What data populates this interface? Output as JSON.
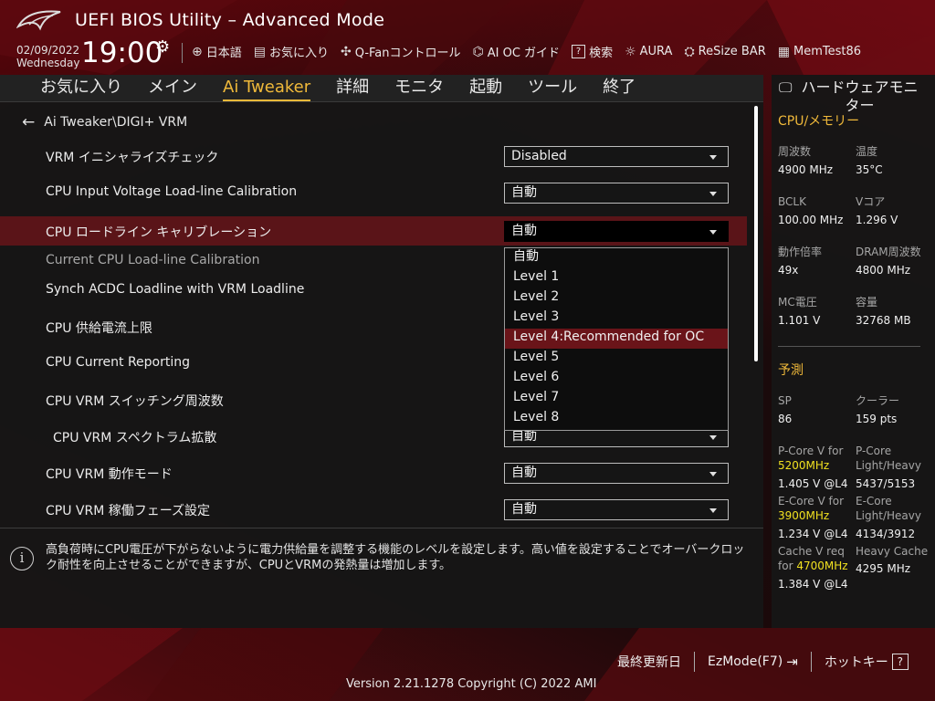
{
  "header": {
    "title": "UEFI BIOS Utility – Advanced Mode",
    "date": "02/09/2022",
    "weekday": "Wednesday",
    "time": "19:00"
  },
  "toolbar": [
    {
      "icon": "globe-icon",
      "label": "日本語"
    },
    {
      "icon": "favorites-icon",
      "label": "お気に入り"
    },
    {
      "icon": "fan-icon",
      "label": "Q-Fanコントロール"
    },
    {
      "icon": "ai-oc-icon",
      "label": "AI OC ガイド"
    },
    {
      "icon": "search-icon",
      "label": "検索"
    },
    {
      "icon": "aura-icon",
      "label": "AURA"
    },
    {
      "icon": "resize-bar-icon",
      "label": "ReSize BAR"
    },
    {
      "icon": "memtest-icon",
      "label": "MemTest86"
    }
  ],
  "nav": {
    "tabs": [
      "お気に入り",
      "メイン",
      "Ai Tweaker",
      "詳細",
      "モニタ",
      "起動",
      "ツール",
      "終了"
    ],
    "active": "Ai Tweaker"
  },
  "breadcrumb": "Ai Tweaker\\DIGI+ VRM",
  "settings": [
    {
      "label": "VRM イニシャライズチェック",
      "value": "Disabled"
    },
    {
      "label": "CPU Input Voltage Load-line Calibration",
      "value": "自動"
    },
    {
      "label": "CPU ロードライン キャリブレーション",
      "value": "自動"
    },
    {
      "label": "Current CPU Load-line Calibration",
      "value": ""
    },
    {
      "label": "Synch ACDC Loadline with VRM Loadline",
      "value": ""
    },
    {
      "label": "CPU 供給電流上限",
      "value": ""
    },
    {
      "label": "CPU Current Reporting",
      "value": ""
    },
    {
      "label": "CPU VRM スイッチング周波数",
      "value": ""
    },
    {
      "label": "CPU VRM スペクトラム拡散",
      "value": "自動"
    },
    {
      "label": "CPU VRM 動作モード",
      "value": "自動"
    },
    {
      "label": "CPU VRM 稼働フェーズ設定",
      "value": "自動"
    }
  ],
  "dropdown": {
    "options": [
      "自動",
      "Level 1",
      "Level 2",
      "Level 3",
      "Level 4:Recommended for OC",
      "Level 5",
      "Level 6",
      "Level 7",
      "Level 8"
    ],
    "highlighted": "Level 4:Recommended for OC"
  },
  "info": {
    "text": "高負荷時にCPU電圧が下がらないように電力供給量を調整する機能のレベルを設定します。高い値を設定することでオーバークロック耐性を向上させることができますが、CPUとVRMの発熱量は増加します。"
  },
  "hardware_monitor": {
    "title": "ハードウェアモニター",
    "cpu_memory_heading": "CPU/メモリー",
    "items": [
      {
        "label": "周波数",
        "value": "4900 MHz"
      },
      {
        "label": "温度",
        "value": "35°C"
      },
      {
        "label": "BCLK",
        "value": "100.00 MHz"
      },
      {
        "label": "Vコア",
        "value": "1.296 V"
      },
      {
        "label": "動作倍率",
        "value": "49x"
      },
      {
        "label": "DRAM周波数",
        "value": "4800 MHz"
      },
      {
        "label": "MC電圧",
        "value": "1.101 V"
      },
      {
        "label": "容量",
        "value": "32768 MB"
      }
    ],
    "prediction_heading": "予測",
    "sp_label": "SP",
    "sp_value": "86",
    "cooler_label": "クーラー",
    "cooler_value": "159 pts",
    "pcore_v_label": "P-Core V for",
    "pcore_v_freq": "5200MHz",
    "pcore_v_value": "1.405 V @L4",
    "pcore_lh_label1": "P-Core",
    "pcore_lh_label2": "Light/Heavy",
    "pcore_lh_value": "5437/5153",
    "ecore_v_label": "E-Core V for",
    "ecore_v_freq": "3900MHz",
    "ecore_v_value": "1.234 V @L4",
    "ecore_lh_label1": "E-Core",
    "ecore_lh_label2": "Light/Heavy",
    "ecore_lh_value": "4134/3912",
    "cache_v_label1": "Cache V req",
    "cache_v_label2": "for",
    "cache_v_freq": "4700MHz",
    "cache_v_value": "1.384 V @L4",
    "heavy_cache_label": "Heavy Cache",
    "heavy_cache_value": "4295 MHz"
  },
  "footer": {
    "last_modified": "最終更新日",
    "ezmode": "EzMode(F7)",
    "hotkeys": "ホットキー",
    "hotkeys_key": "?",
    "version": "Version 2.21.1278 Copyright (C) 2022 AMI"
  },
  "colors": {
    "accent": "#f0b93a",
    "highlight_row": "#5a1418",
    "selected_option": "#6a1419",
    "prediction_value": "#f0e020"
  }
}
